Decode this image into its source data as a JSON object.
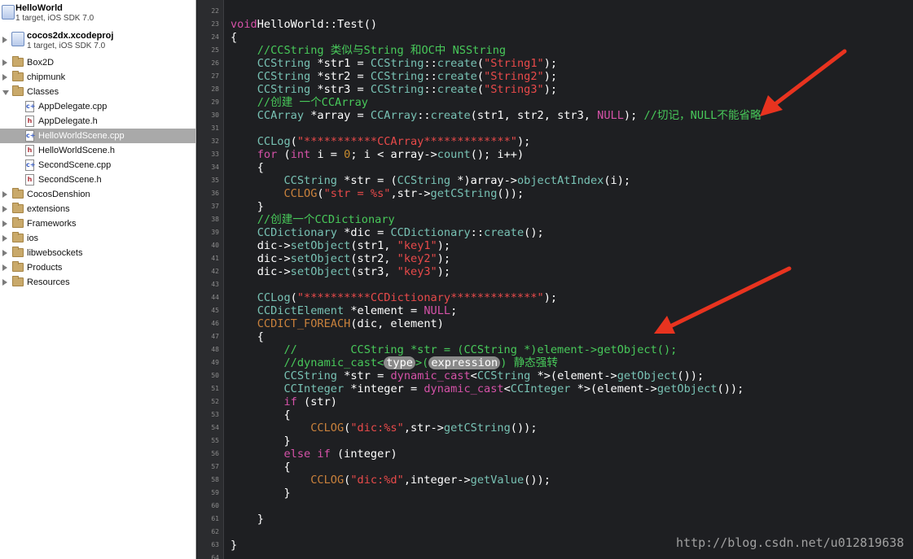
{
  "navigator": {
    "project": {
      "title": "HelloWorld",
      "subtitle": "1 target, iOS SDK 7.0"
    },
    "subproject": {
      "title": "cocos2dx.xcodeproj",
      "subtitle": "1 target, iOS SDK 7.0"
    },
    "groups_top": [
      {
        "label": "Box2D",
        "state": "closed"
      },
      {
        "label": "chipmunk",
        "state": "closed"
      },
      {
        "label": "Classes",
        "state": "open"
      }
    ],
    "files": [
      {
        "label": "AppDelegate.cpp",
        "kind": "cpp",
        "selected": false
      },
      {
        "label": "AppDelegate.h",
        "kind": "h",
        "selected": false
      },
      {
        "label": "HelloWorldScene.cpp",
        "kind": "cpp",
        "selected": true
      },
      {
        "label": "HelloWorldScene.h",
        "kind": "h",
        "selected": false
      },
      {
        "label": "SecondScene.cpp",
        "kind": "cpp",
        "selected": false
      },
      {
        "label": "SecondScene.h",
        "kind": "h",
        "selected": false
      }
    ],
    "groups_bottom": [
      {
        "label": "CocosDenshion",
        "state": "closed"
      },
      {
        "label": "extensions",
        "state": "closed"
      },
      {
        "label": "Frameworks",
        "state": "closed"
      },
      {
        "label": "ios",
        "state": "closed"
      },
      {
        "label": "libwebsockets",
        "state": "closed"
      },
      {
        "label": "Products",
        "state": "closed"
      },
      {
        "label": "Resources",
        "state": "closed"
      }
    ]
  },
  "editor": {
    "line_numbers": [
      "22",
      "23",
      "24",
      "25",
      "26",
      "27",
      "28",
      "29",
      "30",
      "31",
      "32",
      "33",
      "34",
      "35",
      "36",
      "37",
      "38",
      "39",
      "40",
      "41",
      "42",
      "43",
      "44",
      "45",
      "46",
      "47",
      "48",
      "49",
      "50",
      "51",
      "52",
      "53",
      "54",
      "55",
      "56",
      "57",
      "58",
      "59",
      "60",
      "61",
      "62",
      "63",
      "64"
    ],
    "lines": [
      [],
      [
        [
          "kw",
          "void"
        ],
        [
          "",
          "HelloWorld::Test()"
        ]
      ],
      [
        [
          "",
          "{"
        ]
      ],
      [
        [
          "",
          "    "
        ],
        [
          "cm",
          "//CCString 类似与String 和OC中 NSString"
        ]
      ],
      [
        [
          "",
          "    "
        ],
        [
          "ty",
          "CCString"
        ],
        [
          "",
          " *str1 = "
        ],
        [
          "ty",
          "CCString"
        ],
        [
          "",
          "::"
        ],
        [
          "ty",
          "create"
        ],
        [
          "",
          "("
        ],
        [
          "st",
          "\"String1\""
        ],
        [
          "",
          ");"
        ]
      ],
      [
        [
          "",
          "    "
        ],
        [
          "ty",
          "CCString"
        ],
        [
          "",
          " *str2 = "
        ],
        [
          "ty",
          "CCString"
        ],
        [
          "",
          "::"
        ],
        [
          "ty",
          "create"
        ],
        [
          "",
          "("
        ],
        [
          "st",
          "\"String2\""
        ],
        [
          "",
          ");"
        ]
      ],
      [
        [
          "",
          "    "
        ],
        [
          "ty",
          "CCString"
        ],
        [
          "",
          " *str3 = "
        ],
        [
          "ty",
          "CCString"
        ],
        [
          "",
          "::"
        ],
        [
          "ty",
          "create"
        ],
        [
          "",
          "("
        ],
        [
          "st",
          "\"String3\""
        ],
        [
          "",
          ");"
        ]
      ],
      [
        [
          "",
          "    "
        ],
        [
          "cm",
          "//创建 一个CCArray"
        ]
      ],
      [
        [
          "",
          "    "
        ],
        [
          "ty",
          "CCArray"
        ],
        [
          "",
          " *array = "
        ],
        [
          "ty",
          "CCArray"
        ],
        [
          "",
          "::"
        ],
        [
          "ty",
          "create"
        ],
        [
          "",
          "(str1, str2, str3, "
        ],
        [
          "kw",
          "NULL"
        ],
        [
          "",
          "); "
        ],
        [
          "cm",
          "//切记，NULL不能省略"
        ]
      ],
      [],
      [
        [
          "",
          "    "
        ],
        [
          "ty",
          "CCLog"
        ],
        [
          "",
          "("
        ],
        [
          "st",
          "\"***********CCArray*************\""
        ],
        [
          "",
          ");"
        ]
      ],
      [
        [
          "",
          "    "
        ],
        [
          "kw",
          "for"
        ],
        [
          "",
          " ("
        ],
        [
          "kw",
          "int"
        ],
        [
          "",
          " i = "
        ],
        [
          "cn",
          "0"
        ],
        [
          "",
          "; i < array->"
        ],
        [
          "ty",
          "count"
        ],
        [
          "",
          "(); i++)"
        ]
      ],
      [
        [
          "",
          "    {"
        ]
      ],
      [
        [
          "",
          "        "
        ],
        [
          "ty",
          "CCString"
        ],
        [
          "",
          " *str = ("
        ],
        [
          "ty",
          "CCString"
        ],
        [
          "",
          " *)array->"
        ],
        [
          "ty",
          "objectAtIndex"
        ],
        [
          "",
          "(i);"
        ]
      ],
      [
        [
          "",
          "        "
        ],
        [
          "mc",
          "CCLOG"
        ],
        [
          "",
          "("
        ],
        [
          "st",
          "\"str = %s\""
        ],
        [
          "",
          ",str->"
        ],
        [
          "ty",
          "getCString"
        ],
        [
          "",
          "());"
        ]
      ],
      [
        [
          "",
          "    }"
        ]
      ],
      [
        [
          "",
          "    "
        ],
        [
          "cm",
          "//创建一个CCDictionary"
        ]
      ],
      [
        [
          "",
          "    "
        ],
        [
          "ty",
          "CCDictionary"
        ],
        [
          "",
          " *dic = "
        ],
        [
          "ty",
          "CCDictionary"
        ],
        [
          "",
          "::"
        ],
        [
          "ty",
          "create"
        ],
        [
          "",
          "();"
        ]
      ],
      [
        [
          "",
          "    dic->"
        ],
        [
          "ty",
          "setObject"
        ],
        [
          "",
          "(str1, "
        ],
        [
          "st",
          "\"key1\""
        ],
        [
          "",
          ");"
        ]
      ],
      [
        [
          "",
          "    dic->"
        ],
        [
          "ty",
          "setObject"
        ],
        [
          "",
          "(str2, "
        ],
        [
          "st",
          "\"key2\""
        ],
        [
          "",
          ");"
        ]
      ],
      [
        [
          "",
          "    dic->"
        ],
        [
          "ty",
          "setObject"
        ],
        [
          "",
          "(str3, "
        ],
        [
          "st",
          "\"key3\""
        ],
        [
          "",
          ");"
        ]
      ],
      [],
      [
        [
          "",
          "    "
        ],
        [
          "ty",
          "CCLog"
        ],
        [
          "",
          "("
        ],
        [
          "st",
          "\"**********CCDictionary*************\""
        ],
        [
          "",
          ");"
        ]
      ],
      [
        [
          "",
          "    "
        ],
        [
          "ty",
          "CCDictElement"
        ],
        [
          "",
          " *element = "
        ],
        [
          "kw",
          "NULL"
        ],
        [
          "",
          ";"
        ]
      ],
      [
        [
          "",
          "    "
        ],
        [
          "mc",
          "CCDICT_FOREACH"
        ],
        [
          "",
          "(dic, element)"
        ]
      ],
      [
        [
          "",
          "    {"
        ]
      ],
      [
        [
          "",
          "        "
        ],
        [
          "cm",
          "//        CCString *str = (CCString *)element->getObject();"
        ]
      ],
      [
        [
          "",
          "        "
        ],
        [
          "cm",
          "//dynamic_cast<"
        ],
        [
          "ph",
          "type"
        ],
        [
          "cm",
          ">("
        ],
        [
          "ph",
          "expression"
        ],
        [
          "cm",
          ") 静态强转"
        ]
      ],
      [
        [
          "",
          "        "
        ],
        [
          "ty",
          "CCString"
        ],
        [
          "",
          " *str = "
        ],
        [
          "kw",
          "dynamic_cast"
        ],
        [
          "",
          "<"
        ],
        [
          "ty",
          "CCString"
        ],
        [
          "",
          " *>(element->"
        ],
        [
          "ty",
          "getObject"
        ],
        [
          "",
          "());"
        ]
      ],
      [
        [
          "",
          "        "
        ],
        [
          "ty",
          "CCInteger"
        ],
        [
          "",
          " *integer = "
        ],
        [
          "kw",
          "dynamic_cast"
        ],
        [
          "",
          "<"
        ],
        [
          "ty",
          "CCInteger"
        ],
        [
          "",
          " *>(element->"
        ],
        [
          "ty",
          "getObject"
        ],
        [
          "",
          "());"
        ]
      ],
      [
        [
          "",
          "        "
        ],
        [
          "kw",
          "if"
        ],
        [
          "",
          " (str)"
        ]
      ],
      [
        [
          "",
          "        {"
        ]
      ],
      [
        [
          "",
          "            "
        ],
        [
          "mc",
          "CCLOG"
        ],
        [
          "",
          "("
        ],
        [
          "st",
          "\"dic:%s\""
        ],
        [
          "",
          ",str->"
        ],
        [
          "ty",
          "getCString"
        ],
        [
          "",
          "());"
        ]
      ],
      [
        [
          "",
          "        }"
        ]
      ],
      [
        [
          "",
          "        "
        ],
        [
          "kw",
          "else if"
        ],
        [
          "",
          " (integer)"
        ]
      ],
      [
        [
          "",
          "        {"
        ]
      ],
      [
        [
          "",
          "            "
        ],
        [
          "mc",
          "CCLOG"
        ],
        [
          "",
          "("
        ],
        [
          "st",
          "\"dic:%d\""
        ],
        [
          "",
          ",integer->"
        ],
        [
          "ty",
          "getValue"
        ],
        [
          "",
          "());"
        ]
      ],
      [
        [
          "",
          "        }"
        ]
      ],
      [],
      [
        [
          "",
          "    }"
        ]
      ],
      [],
      [
        [
          "",
          "}"
        ]
      ],
      []
    ]
  },
  "watermark": "http://blog.csdn.net/u012819638",
  "colors": {
    "arrow": "#e8331f",
    "keyword": "#d552a8",
    "type": "#78c2b4",
    "string": "#e84a4a",
    "comment": "#48c95a"
  }
}
